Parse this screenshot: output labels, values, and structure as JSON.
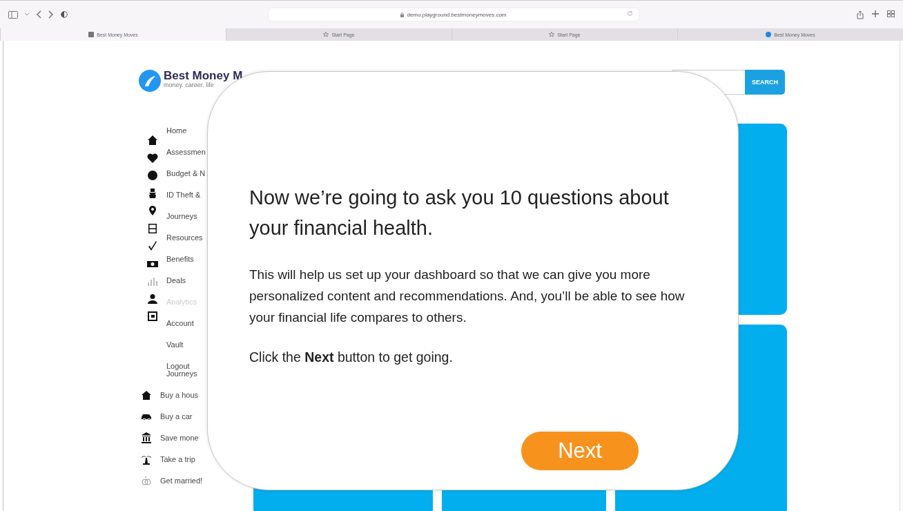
{
  "browser": {
    "url": "demo.playground.bestmoneymoves.com",
    "tabs": [
      {
        "label": "Best Money Moves",
        "selected": true
      },
      {
        "label": "Start Page",
        "selected": false
      },
      {
        "label": "Start Page",
        "selected": false
      },
      {
        "label": "Best Money Moves",
        "selected": false
      }
    ]
  },
  "site": {
    "logo": {
      "name": "Best Money M",
      "tagline": "money. career. life"
    },
    "search": {
      "button": "SEARCH"
    },
    "sidebar": {
      "items": [
        {
          "label": "Home",
          "disabled": false
        },
        {
          "label": "Assessmen",
          "disabled": false
        },
        {
          "label": "Budget & N",
          "disabled": false
        },
        {
          "label": "ID Theft &",
          "disabled": false
        },
        {
          "label": "Journeys",
          "disabled": false
        },
        {
          "label": "Resources",
          "disabled": false
        },
        {
          "label": "Benefits",
          "disabled": false
        },
        {
          "label": "Deals",
          "disabled": false
        },
        {
          "label": "Analytics",
          "disabled": true
        },
        {
          "label": "Account",
          "disabled": false
        },
        {
          "label": "Vault",
          "disabled": false
        },
        {
          "label": "Logout",
          "disabled": false
        }
      ],
      "section_title": "Journeys",
      "journeys": [
        {
          "label": "Buy a hous"
        },
        {
          "label": "Buy a car"
        },
        {
          "label": "Save mone"
        },
        {
          "label": "Take a trip"
        },
        {
          "label": "Get married!"
        }
      ]
    }
  },
  "modal": {
    "heading": "Now we’re going to ask you 10 questions about your financial health.",
    "body": "This will help us set up your dashboard so that we can give you more personalized content and recommendations. And, you’ll be able to see how your financial life compares to others.",
    "prompt": "Click the **Next** button to get going.",
    "button": "Next"
  }
}
